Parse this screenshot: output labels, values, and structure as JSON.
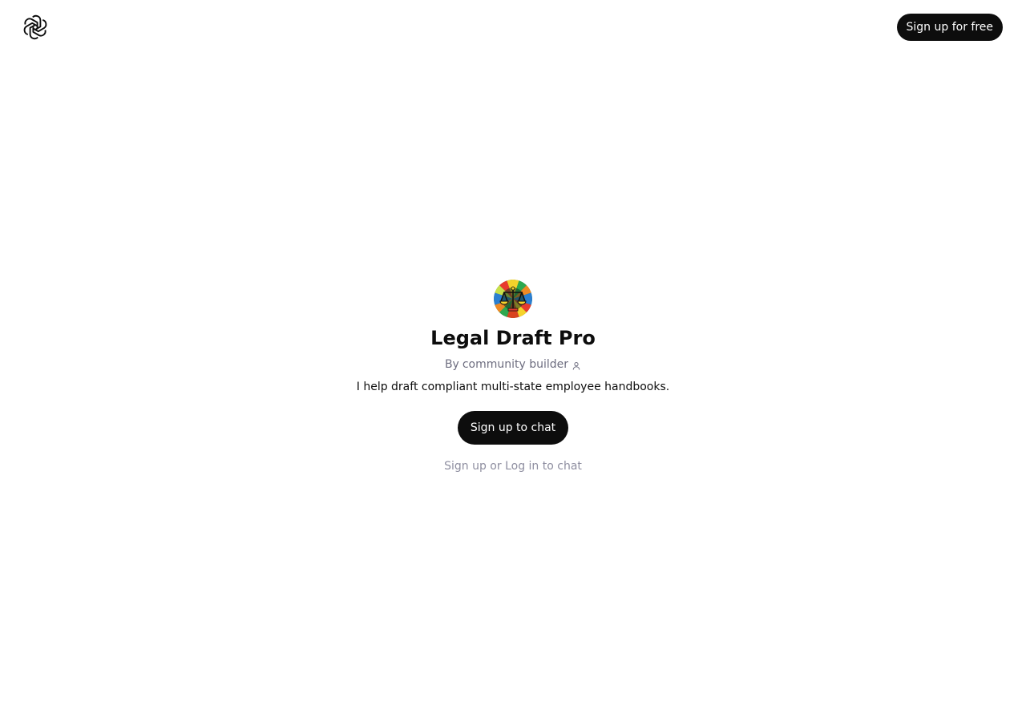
{
  "header": {
    "logo_icon": "openai-logo-icon",
    "signup_free_label": "Sign up for free"
  },
  "gpt": {
    "avatar_icon": "scales-of-justice-avatar",
    "title": "Legal Draft Pro",
    "by_prefix": "By",
    "author": "community builder",
    "author_icon": "person-icon",
    "description": "I help draft compliant multi-state employee handbooks."
  },
  "actions": {
    "signup_chat_label": "Sign up to chat",
    "signup_link": "Sign up",
    "or_text": "or",
    "login_link": "Log in to chat"
  },
  "colors": {
    "primary_button": "#0d0d0d",
    "muted_text": "#8e8ea0",
    "byline_text": "#6e6e80"
  }
}
